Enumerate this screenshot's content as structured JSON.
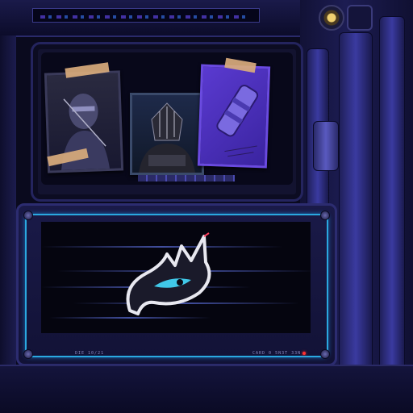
{
  "scene": {
    "colors": {
      "frame": "#1c1c52",
      "accent_cyan": "#2aa8e0",
      "accent_purple": "#6b4cff",
      "tape": "#d9ab7c",
      "screen_bg": "#05050f",
      "indicator_light": "#f0d070",
      "status_led": "#ff3030"
    },
    "photos": [
      {
        "icon": "masked-figure-photo"
      },
      {
        "icon": "armored-figure-photo"
      },
      {
        "icon": "canister-photo"
      }
    ],
    "screen": {
      "icon": "flame-eye-emblem",
      "label_left": "DIE 10/21",
      "label_right": "CARD 0 5N3T 33N"
    }
  }
}
